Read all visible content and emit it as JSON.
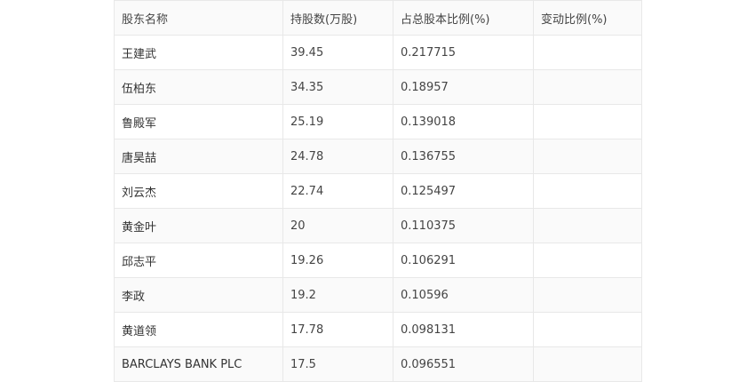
{
  "table": {
    "headers": [
      "股东名称",
      "持股数(万股)",
      "占总股本比例(%)",
      "变动比例(%)"
    ],
    "rows": [
      [
        "王建武",
        "39.45",
        "0.217715",
        ""
      ],
      [
        "伍柏东",
        "34.35",
        "0.18957",
        ""
      ],
      [
        "鲁殿军",
        "25.19",
        "0.139018",
        ""
      ],
      [
        "唐昊喆",
        "24.78",
        "0.136755",
        ""
      ],
      [
        "刘云杰",
        "22.74",
        "0.125497",
        ""
      ],
      [
        "黄金叶",
        "20",
        "0.110375",
        ""
      ],
      [
        "邱志平",
        "19.26",
        "0.106291",
        ""
      ],
      [
        "李政",
        "19.2",
        "0.10596",
        ""
      ],
      [
        "黄道领",
        "17.78",
        "0.098131",
        ""
      ],
      [
        "BARCLAYS BANK PLC",
        "17.5",
        "0.096551",
        ""
      ]
    ]
  }
}
